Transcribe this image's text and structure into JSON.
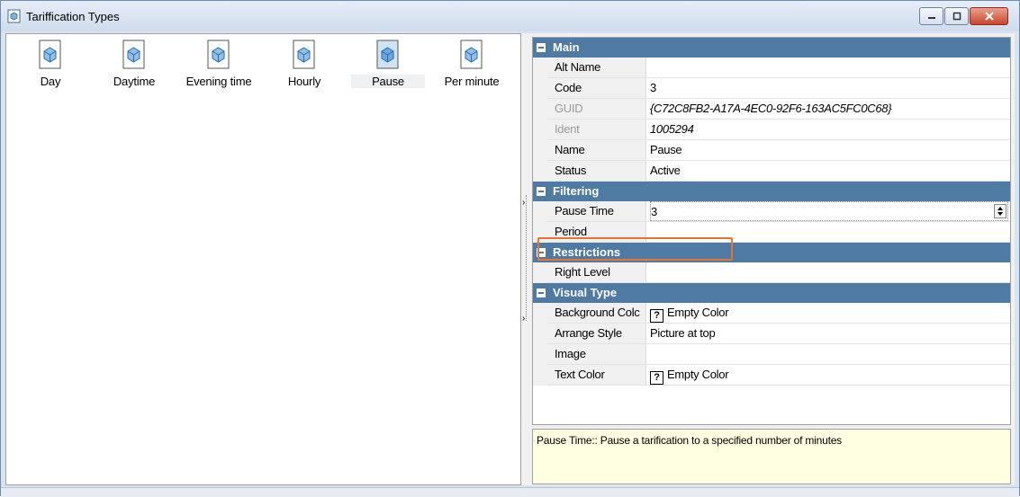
{
  "window": {
    "title": "Tariffication Types"
  },
  "types": [
    {
      "label": "Day"
    },
    {
      "label": "Daytime"
    },
    {
      "label": "Evening time"
    },
    {
      "label": "Hourly"
    },
    {
      "label": "Pause"
    },
    {
      "label": "Per minute"
    }
  ],
  "grid": {
    "main": {
      "title": "Main",
      "alt_name": {
        "label": "Alt Name",
        "value": ""
      },
      "code": {
        "label": "Code",
        "value": "3"
      },
      "guid": {
        "label": "GUID",
        "value": "{C72C8FB2-A17A-4EC0-92F6-163AC5FC0C68}"
      },
      "ident": {
        "label": "Ident",
        "value": "1005294"
      },
      "name": {
        "label": "Name",
        "value": "Pause"
      },
      "status": {
        "label": "Status",
        "value": "Active"
      }
    },
    "filtering": {
      "title": "Filtering",
      "pause_time": {
        "label": "Pause Time",
        "value": "3"
      },
      "period": {
        "label": "Period",
        "value": ""
      }
    },
    "restrictions": {
      "title": "Restrictions",
      "right_level": {
        "label": "Right Level",
        "value": ""
      }
    },
    "visual": {
      "title": "Visual Type",
      "background_color": {
        "label": "Background Colc",
        "value": "Empty Color"
      },
      "arrange_style": {
        "label": "Arrange Style",
        "value": "Picture at top"
      },
      "image": {
        "label": "Image",
        "value": ""
      },
      "text_color": {
        "label": "Text Color",
        "value": "Empty Color"
      }
    },
    "unknown_glyph": "?"
  },
  "description": {
    "text": "Pause Time:: Pause a tarification to a specified number of minutes"
  },
  "colors": {
    "category_header": "#4f7aa4",
    "highlight": "#e8752f",
    "description_bg": "#ffffe1"
  }
}
